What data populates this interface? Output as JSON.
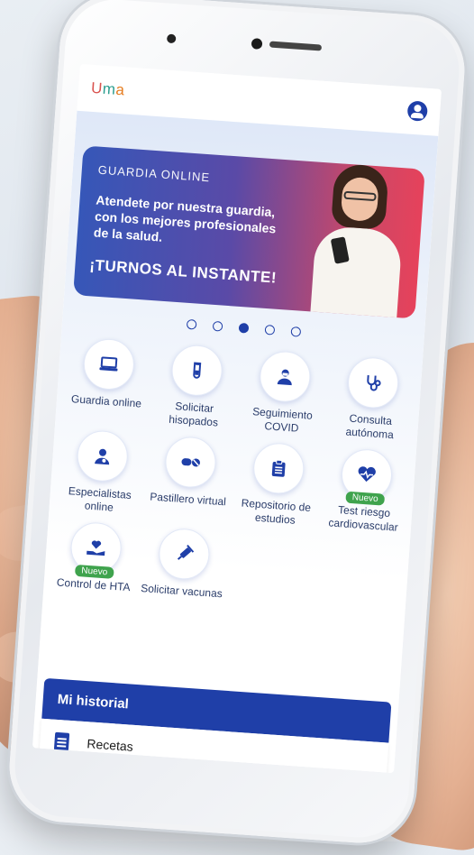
{
  "app": {
    "logo_letters": [
      "U",
      "m",
      "a"
    ]
  },
  "header": {
    "profile_icon": "user-circle-icon"
  },
  "banner": {
    "kicker": "GUARDIA ONLINE",
    "message": "Atendete por nuestra guardia, con los mejores profesionales de la salud.",
    "cta": "¡TURNOS AL INSTANTE!"
  },
  "carousel": {
    "count": 5,
    "active_index": 2
  },
  "services": [
    {
      "label": "Guardia online",
      "icon": "laptop-icon",
      "badge": ""
    },
    {
      "label": "Solicitar hisopados",
      "icon": "test-tube-icon",
      "badge": ""
    },
    {
      "label": "Seguimiento COVID",
      "icon": "doctor-mask-icon",
      "badge": ""
    },
    {
      "label": "Consulta autónoma",
      "icon": "stethoscope-icon",
      "badge": ""
    },
    {
      "label": "Especialistas online",
      "icon": "specialist-icon",
      "badge": ""
    },
    {
      "label": "Pastillero virtual",
      "icon": "pills-icon",
      "badge": ""
    },
    {
      "label": "Repositorio de estudios",
      "icon": "clipboard-icon",
      "badge": ""
    },
    {
      "label": "Test riesgo cardiovascular",
      "icon": "heart-pulse-icon",
      "badge": "Nuevo"
    },
    {
      "label": "Control de HTA",
      "icon": "heart-hand-icon",
      "badge": "Nuevo"
    },
    {
      "label": "Solicitar vacunas",
      "icon": "syringe-icon",
      "badge": ""
    }
  ],
  "history": {
    "title": "Mi historial",
    "items": [
      {
        "label": "Recetas",
        "icon": "document-icon"
      }
    ]
  },
  "colors": {
    "primary": "#1f3fa8",
    "badge": "#3fa34d",
    "banner_start": "#3657b8",
    "banner_end": "#e6425b"
  }
}
